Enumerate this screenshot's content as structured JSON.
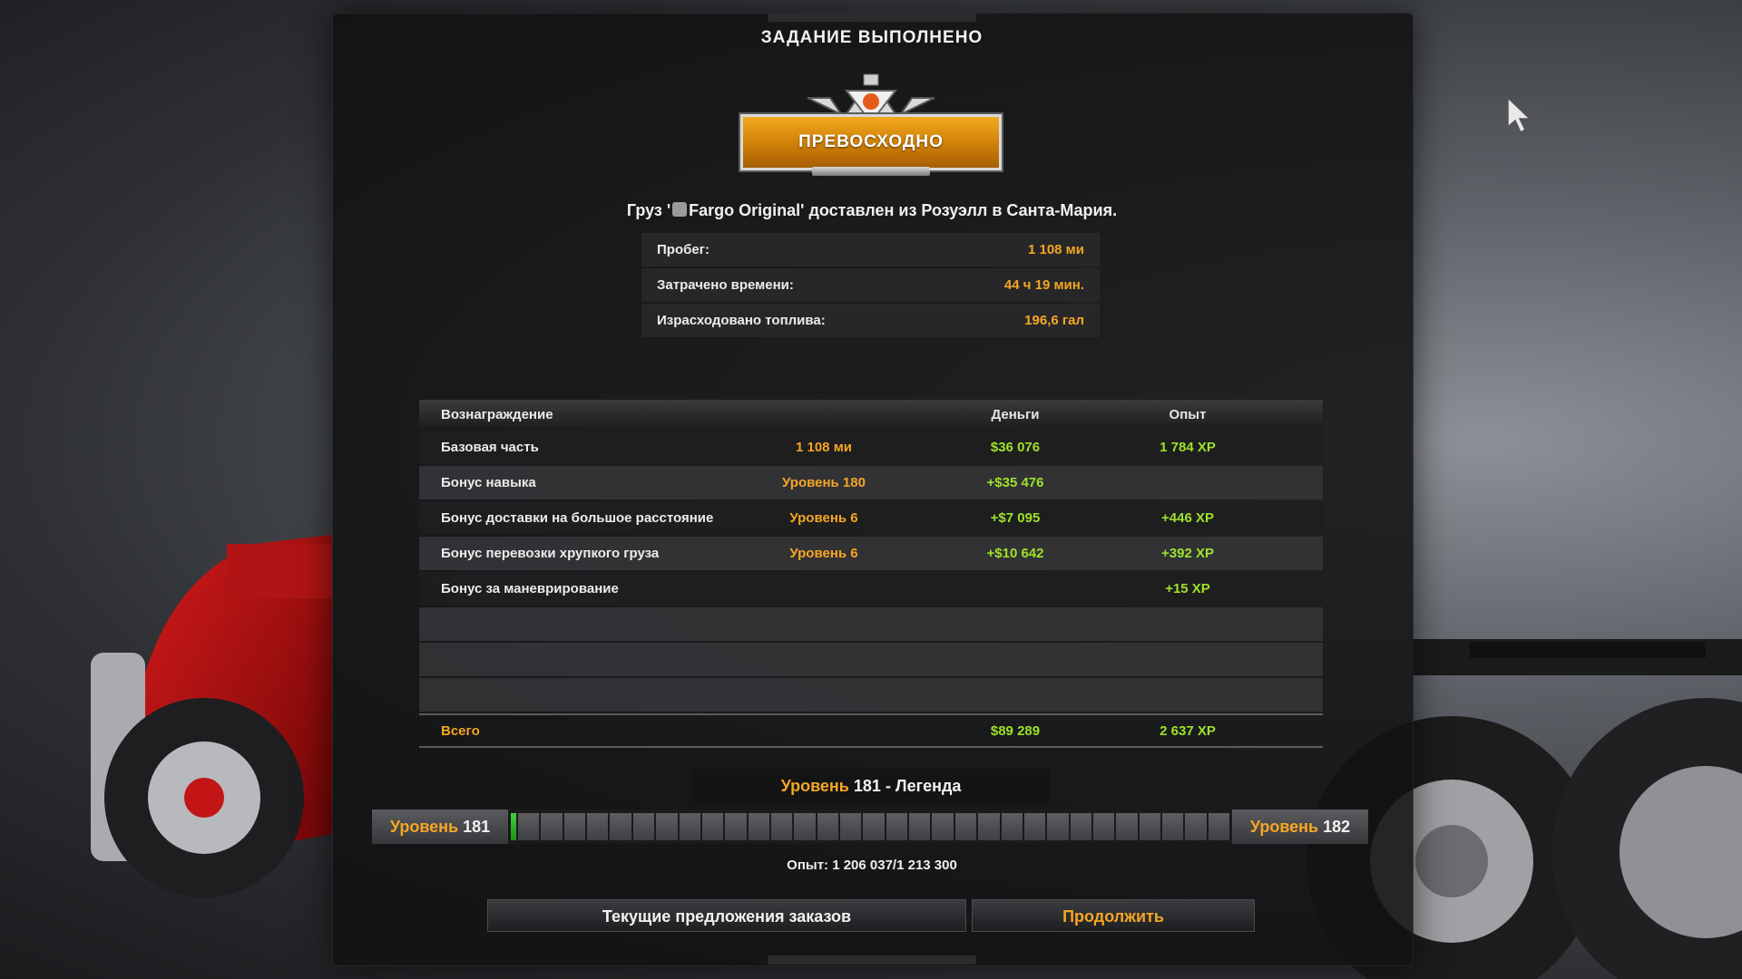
{
  "window_title": "ЗАДАНИЕ ВЫПОЛНЕНО",
  "rating": {
    "label": "ПРЕВОСХОДНО"
  },
  "cargo_line": {
    "prefix": "Груз '",
    "cargo_name": "Fargo Original",
    "suffix": "' доставлен из Розуэлл в Санта-Мария."
  },
  "stats": [
    {
      "label": "Пробег:",
      "value": "1 108 ми"
    },
    {
      "label": "Затрачено времени:",
      "value": "44 ч 19 мин."
    },
    {
      "label": "Израсходовано топлива:",
      "value": "196,6 гал"
    }
  ],
  "rewards": {
    "header": {
      "name": "Вознаграждение",
      "money": "Деньги",
      "xp": "Опыт"
    },
    "rows": [
      {
        "name": "Базовая часть",
        "extra": "1 108 ми",
        "money": "$36 076",
        "xp": "1 784 XP"
      },
      {
        "name": "Бонус навыка",
        "extra": "Уровень 180",
        "money": "+$35 476",
        "xp": ""
      },
      {
        "name": "Бонус доставки на большое расстояние",
        "extra": "Уровень 6",
        "money": "+$7 095",
        "xp": "+446 XP"
      },
      {
        "name": "Бонус перевозки хрупкого груза",
        "extra": "Уровень 6",
        "money": "+$10 642",
        "xp": "+392 XP"
      },
      {
        "name": "Бонус за маневрирование",
        "extra": "",
        "money": "",
        "xp": "+15 XP"
      },
      {
        "name": "",
        "extra": "",
        "money": "",
        "xp": ""
      },
      {
        "name": "",
        "extra": "",
        "money": "",
        "xp": ""
      },
      {
        "name": "",
        "extra": "",
        "money": "",
        "xp": ""
      }
    ],
    "total": {
      "name": "Всего",
      "money": "$89 289",
      "xp": "2 637 XP"
    }
  },
  "level": {
    "word": "Уровень",
    "current": "181",
    "rank": " - Легенда",
    "left_word": "Уровень",
    "left_num": "181",
    "right_word": "Уровень",
    "right_num": "182",
    "progress_fraction": 0.02,
    "segments": 32
  },
  "experience": "Опыт: 1 206 037/1 213 300",
  "buttons": {
    "offers": "Текущие предложения заказов",
    "continue": "Продолжить"
  },
  "colors": {
    "accent": "#f5a623",
    "positive": "#9ee12a",
    "badge": "#e8951a"
  }
}
